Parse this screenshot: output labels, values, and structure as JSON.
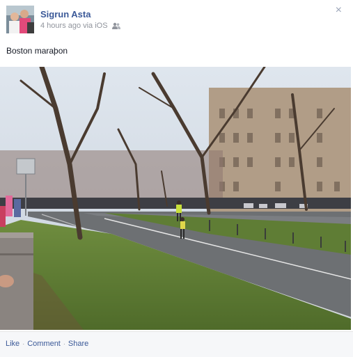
{
  "post": {
    "author": "Sigrun Asta",
    "time": "4 hours ago",
    "via": "via iOS",
    "privacy_icon": "friends-icon",
    "close_symbol": "×",
    "message": "Boston maraþon"
  },
  "photo": {
    "subject": "photo-of-marathon-street"
  },
  "actions": {
    "like": "Like",
    "comment": "Comment",
    "share": "Share",
    "separator": "·"
  },
  "colors": {
    "link": "#3b5998",
    "meta": "#90949c",
    "action_bar": "#f6f7f9"
  }
}
